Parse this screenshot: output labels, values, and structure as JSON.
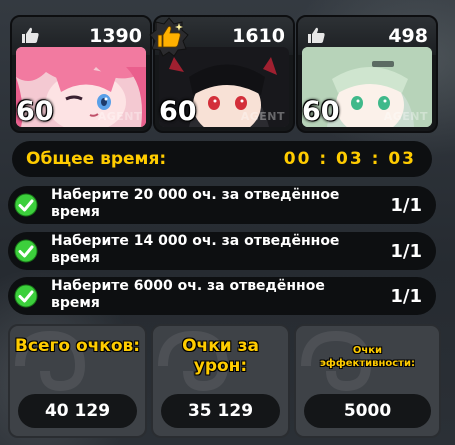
{
  "agents": [
    {
      "likes": "1390",
      "level": "60",
      "tag": "AGENT",
      "liked": false
    },
    {
      "likes": "1610",
      "level": "60",
      "tag": "AGENT",
      "liked": true
    },
    {
      "likes": "498",
      "level": "60",
      "tag": "AGENT",
      "liked": false
    }
  ],
  "timer": {
    "label": "Общее время:",
    "value": "00 : 03 : 03"
  },
  "tasks": [
    {
      "text": "Наберите 20 000 оч. за отведённое время",
      "progress": "1/1"
    },
    {
      "text": "Наберите 14 000 оч. за отведённое время",
      "progress": "1/1"
    },
    {
      "text": "Наберите 6000 оч. за отведённое время",
      "progress": "1/1"
    }
  ],
  "stats": [
    {
      "title": "Всего очков:",
      "value": "40 129"
    },
    {
      "title": "Очки за урон:",
      "value": "35 129"
    },
    {
      "title": "Очки эффективности:",
      "value": "5000"
    }
  ],
  "colors": {
    "accent": "#ffcc00",
    "check": "#3ccf3c",
    "panel": "#0d0f11"
  }
}
